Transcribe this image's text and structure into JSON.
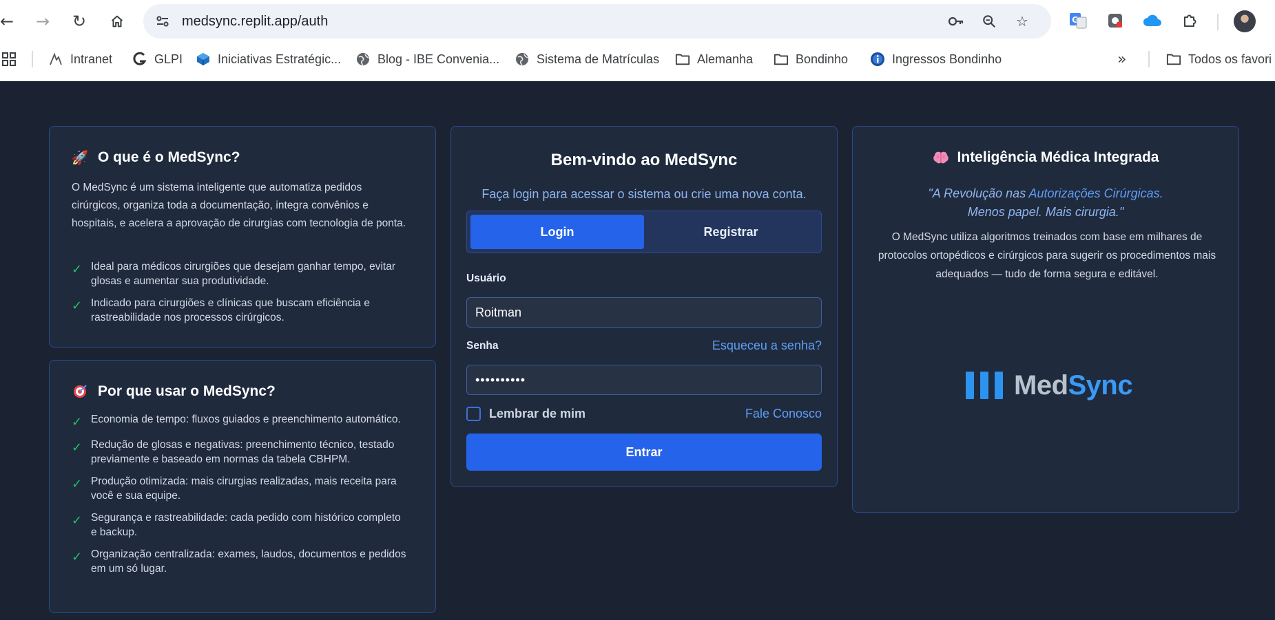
{
  "browser": {
    "url": "medsync.replit.app/auth",
    "bookmarks": [
      {
        "label": "Intranet",
        "icon": "intranet-icon"
      },
      {
        "label": "GLPI",
        "icon": "glpi-icon"
      },
      {
        "label": "Iniciativas Estratégic...",
        "icon": "cube-icon"
      },
      {
        "label": "Blog - IBE Convenia...",
        "icon": "globe-icon"
      },
      {
        "label": "Sistema de Matrículas",
        "icon": "globe-icon"
      },
      {
        "label": "Alemanha",
        "icon": "folder-icon"
      },
      {
        "label": "Bondinho",
        "icon": "folder-icon"
      },
      {
        "label": "Ingressos Bondinho",
        "icon": "info-icon"
      }
    ],
    "all_bookmarks_label": "Todos os favori"
  },
  "info_card": {
    "title": "O que é o MedSync?",
    "icon": "rocket-icon",
    "description": "O MedSync é um sistema inteligente que automatiza pedidos cirúrgicos, organiza toda a documentação, integra convênios e hospitais, e acelera a aprovação de cirurgias com tecnologia de ponta.",
    "items": [
      "Ideal para médicos cirurgiões que desejam ganhar tempo, evitar glosas e aumentar sua produtividade.",
      "Indicado para cirurgiões e clínicas que buscam eficiência e rastreabilidade nos processos cirúrgicos."
    ]
  },
  "why_card": {
    "title": "Por que usar o MedSync?",
    "icon": "target-icon",
    "items": [
      "Economia de tempo: fluxos guiados e preenchimento automático.",
      "Redução de glosas e negativas: preenchimento técnico, testado previamente e baseado em normas da tabela CBHPM.",
      "Produção otimizada: mais cirurgias realizadas, mais receita para você e sua equipe.",
      "Segurança e rastreabilidade: cada pedido com histórico completo e backup.",
      "Organização centralizada: exames, laudos, documentos e pedidos em um só lugar."
    ]
  },
  "login": {
    "title": "Bem-vindo ao MedSync",
    "subtitle": "Faça login para acessar o sistema ou crie uma nova conta.",
    "tabs": {
      "login": "Login",
      "register": "Registrar"
    },
    "username_label": "Usuário",
    "username_value": "Roitman",
    "password_label": "Senha",
    "password_value": "••••••••••",
    "forgot_link": "Esqueceu a senha?",
    "remember_label": "Lembrar de mim",
    "contact_link": "Fale Conosco",
    "submit_label": "Entrar"
  },
  "ai_card": {
    "title": "Inteligência Médica Integrada",
    "icon": "brain-icon",
    "quote_open": "\"A Revolução nas ",
    "quote_highlight": "Autorizações Cirúrgicas.",
    "quote_line2": "Menos papel. Mais cirurgia.\"",
    "description": "O MedSync utiliza algoritmos treinados com base em milhares de protocolos ortopédicos e cirúrgicos para sugerir os procedimentos mais adequados — tudo de forma segura e editável.",
    "logo_med": "Med",
    "logo_sync": "Sync"
  },
  "colors": {
    "page_bg": "#1b2333",
    "card_bg": "#1f2a3d",
    "accent": "#2563eb",
    "link": "#5f9ef5",
    "check": "#22c55e"
  }
}
